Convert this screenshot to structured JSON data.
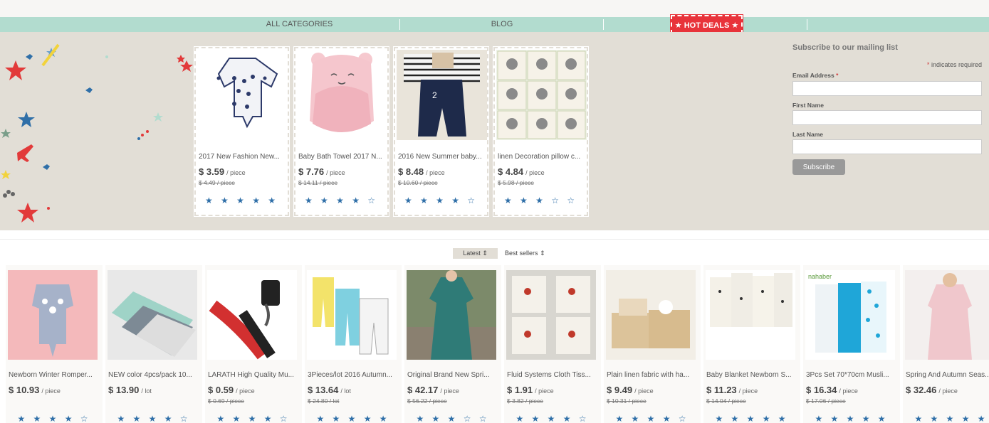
{
  "nav": {
    "all_categories": "ALL CATEGORIES",
    "blog": "BLOG",
    "hot_deals": "HOT DEALS",
    "star_glyph": "★"
  },
  "deals": [
    {
      "title": "2017 New Fashion New...",
      "price": "$ 3.59",
      "unit": "/ piece",
      "old_price": "$ 4.49 / piece",
      "stars": "★ ★ ★ ★ ★",
      "image": "baby-romper-image"
    },
    {
      "title": "Baby Bath Towel 2017 N...",
      "price": "$ 7.76",
      "unit": "/ piece",
      "old_price": "$ 14.11 / piece",
      "stars": "★ ★ ★ ★ ☆",
      "image": "baby-towel-image"
    },
    {
      "title": "2016 New Summer baby...",
      "price": "$ 8.48",
      "unit": "/ piece",
      "old_price": "$ 10.60 / piece",
      "stars": "★ ★ ★ ★ ☆",
      "image": "baby-overalls-image"
    },
    {
      "title": "linen Decoration pillow c...",
      "price": "$ 4.84",
      "unit": "/ piece",
      "old_price": "$ 5.98 / piece",
      "stars": "★ ★ ★ ☆ ☆",
      "image": "cat-pillow-image"
    }
  ],
  "subscribe": {
    "title": "Subscribe to our mailing list",
    "req_marker": "*",
    "required_note": "indicates required",
    "email_label": "Email Address",
    "first_name_label": "First Name",
    "last_name_label": "Last Name",
    "email_value": "",
    "first_name_value": "",
    "last_name_value": "",
    "button": "Subscribe"
  },
  "sort": {
    "latest": "Latest ⇕",
    "best_sellers": "Best sellers ⇕"
  },
  "products": [
    {
      "title": "Newborn Winter Romper...",
      "price": "$ 10.93",
      "unit": "/ piece",
      "old_price": "",
      "stars": "★ ★ ★ ★ ☆"
    },
    {
      "title": "NEW color 4pcs/pack 10...",
      "price": "$ 13.90",
      "unit": "/ lot",
      "old_price": "",
      "stars": "★ ★ ★ ★ ☆"
    },
    {
      "title": "LARATH High Quality Mu...",
      "price": "$ 0.59",
      "unit": "/ piece",
      "old_price": "$ 0.69 / piece",
      "stars": "★ ★ ★ ★ ☆"
    },
    {
      "title": "3Pieces/lot 2016 Autumn...",
      "price": "$ 13.64",
      "unit": "/ lot",
      "old_price": "$ 24.80 / lot",
      "stars": "★ ★ ★ ★ ★"
    },
    {
      "title": "Original Brand New Spri...",
      "price": "$ 42.17",
      "unit": "/ piece",
      "old_price": "$ 56.22 / piece",
      "stars": "★ ★ ★ ☆ ☆"
    },
    {
      "title": "Fluid Systems Cloth Tiss...",
      "price": "$ 1.91",
      "unit": "/ piece",
      "old_price": "$ 3.82 / piece",
      "stars": "★ ★ ★ ★ ☆"
    },
    {
      "title": "Plain linen fabric with ha...",
      "price": "$ 9.49",
      "unit": "/ piece",
      "old_price": "$ 10.31 / piece",
      "stars": "★ ★ ★ ★ ☆"
    },
    {
      "title": "Baby Blanket Newborn S...",
      "price": "$ 11.23",
      "unit": "/ piece",
      "old_price": "$ 14.04 / piece",
      "stars": "★ ★ ★ ★ ★"
    },
    {
      "title": "3Pcs Set 70*70cm Musli...",
      "price": "$ 16.34",
      "unit": "/ piece",
      "old_price": "$ 17.06 / piece",
      "stars": "★ ★ ★ ★ ★"
    },
    {
      "title": "Spring And Autumn Seas...",
      "price": "$ 32.46",
      "unit": "/ piece",
      "old_price": "",
      "stars": "★ ★ ★ ★ ★"
    }
  ],
  "product_images": {
    "p0": "grey-romper-image",
    "p1": "muslin-blankets-image",
    "p2": "stroller-hooks-image",
    "p3": "baby-pants-image",
    "p4": "teal-dress-image",
    "p5": "cloth-tissue-bags-image",
    "p6": "linen-storage-baskets-image",
    "p7": "baby-blanket-image",
    "p8": "muslin-swaddle-image",
    "p9": "pink-robe-image"
  },
  "colors": {
    "nav_bar": "#b2dccf",
    "hero_bg": "#e2ded6",
    "hot_red": "#e8333a",
    "star_blue": "#2f6fa8"
  }
}
